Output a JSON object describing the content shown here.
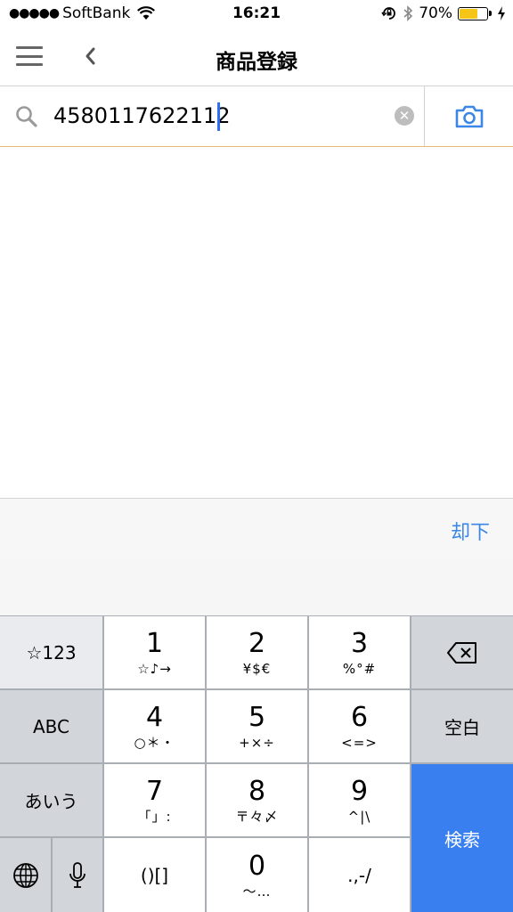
{
  "status_bar": {
    "signal_dots": "●●●●●",
    "carrier": "SoftBank",
    "time": "16:21",
    "battery_percent": "70%",
    "battery_level": 0.7,
    "icons": [
      "wifi-icon",
      "orientation-lock-icon",
      "bluetooth-icon",
      "battery-icon",
      "charging-bolt-icon"
    ]
  },
  "nav": {
    "title": "商品登録",
    "menu_icon": "hamburger-menu-icon",
    "back_icon": "chevron-left-icon"
  },
  "search": {
    "value": "4580117622112",
    "clear_icon": "clear-x-icon",
    "camera_icon": "camera-icon",
    "accent_color": "#e3b877"
  },
  "accessory": {
    "dismiss_label": "却下"
  },
  "keyboard": {
    "left_keys": [
      "☆123",
      "ABC",
      "あいう"
    ],
    "globe_icon": "globe-icon",
    "mic_icon": "microphone-icon",
    "digits": [
      {
        "main": "1",
        "sub": "☆♪→"
      },
      {
        "main": "2",
        "sub": "¥$€"
      },
      {
        "main": "3",
        "sub": "%°#"
      },
      {
        "main": "4",
        "sub": "○＊・"
      },
      {
        "main": "5",
        "sub": "+×÷"
      },
      {
        "main": "6",
        "sub": "<=>"
      },
      {
        "main": "7",
        "sub": "「」:"
      },
      {
        "main": "8",
        "sub": "〒々〆"
      },
      {
        "main": "9",
        "sub": "^|\\"
      },
      {
        "main": "0",
        "sub": "〜…"
      }
    ],
    "brackets_label": "()[]",
    "punct_label": ".,-/",
    "backspace_icon": "backspace-icon",
    "space_label": "空白",
    "search_label": "検索",
    "search_color": "#3a7ff0"
  }
}
